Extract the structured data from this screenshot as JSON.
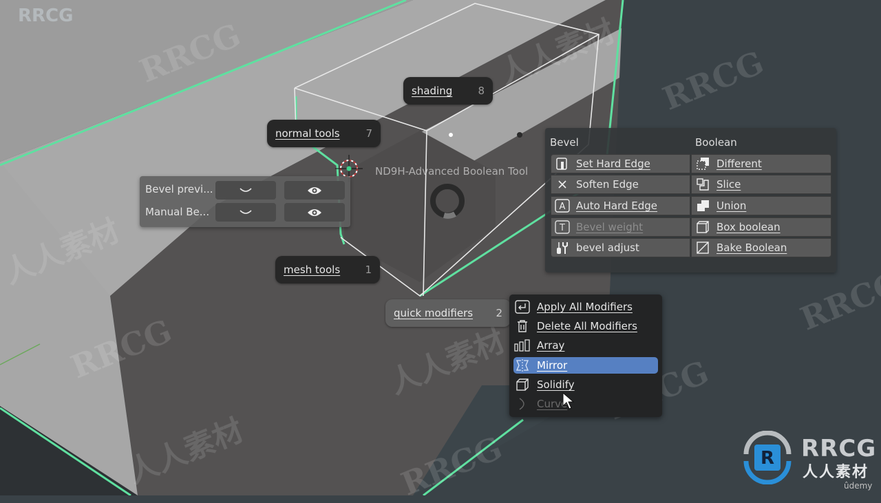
{
  "viewport": {
    "background_color": "#3a4247",
    "selection_outline_color": "#5fe0a0",
    "tool_label": "ND9H-Advanced Boolean Tool"
  },
  "pie_menu": {
    "items": [
      {
        "label": "shading",
        "key": "8"
      },
      {
        "label": "normal tools",
        "key": "7"
      },
      {
        "label": "mesh tools",
        "key": "1"
      },
      {
        "label": "quick modifiers",
        "key": "2"
      }
    ]
  },
  "bevel_preview_panel": {
    "rows": [
      {
        "label": "Bevel previ...",
        "dropdown_icon": "chevron-down-icon",
        "toggle_icon": "eye-icon"
      },
      {
        "label": "Manual Be...",
        "dropdown_icon": "chevron-down-icon",
        "toggle_icon": "eye-icon"
      }
    ]
  },
  "bevel_boolean_panel": {
    "bevel_header": "Bevel",
    "boolean_header": "Boolean",
    "bevel_items": [
      {
        "label": "Set Hard Edge",
        "icon": "hard-edge-icon",
        "enabled": true
      },
      {
        "label": "Soften Edge",
        "icon": "x-icon",
        "enabled": true
      },
      {
        "label": "Auto Hard Edge",
        "icon": "letter-a-icon",
        "enabled": true
      },
      {
        "label": "Bevel weight",
        "icon": "letter-t-icon",
        "enabled": false
      },
      {
        "label": "bevel adjust",
        "icon": "tools-icon",
        "enabled": true
      }
    ],
    "boolean_items": [
      {
        "label": "Different",
        "icon": "boolean-difference-icon",
        "enabled": true
      },
      {
        "label": "Slice",
        "icon": "boolean-slice-icon",
        "enabled": true
      },
      {
        "label": "Union",
        "icon": "boolean-union-icon",
        "enabled": true
      },
      {
        "label": "Box boolean",
        "icon": "cube-icon",
        "enabled": true
      },
      {
        "label": "Bake Boolean",
        "icon": "bake-icon",
        "enabled": true
      }
    ]
  },
  "modifiers_menu": {
    "items": [
      {
        "label": "Apply All Modifiers",
        "icon": "apply-icon",
        "state": "normal"
      },
      {
        "label": "Delete All Modifiers",
        "icon": "trash-icon",
        "state": "normal"
      },
      {
        "label": "Array",
        "icon": "array-icon",
        "state": "normal"
      },
      {
        "label": "Mirror",
        "icon": "mirror-icon",
        "state": "selected"
      },
      {
        "label": "Solidify",
        "icon": "solidify-icon",
        "state": "normal"
      },
      {
        "label": "Curve",
        "icon": "curve-icon",
        "state": "disabled"
      }
    ],
    "highlight_color": "#5680c2"
  },
  "watermarks": {
    "corner_text": "RRCG",
    "logo_text": "RRCG",
    "logo_subtitle": "人人素材",
    "repeated_latin": "RRCG",
    "repeated_cjk": "人人素材",
    "udemy": "ûdemy"
  }
}
